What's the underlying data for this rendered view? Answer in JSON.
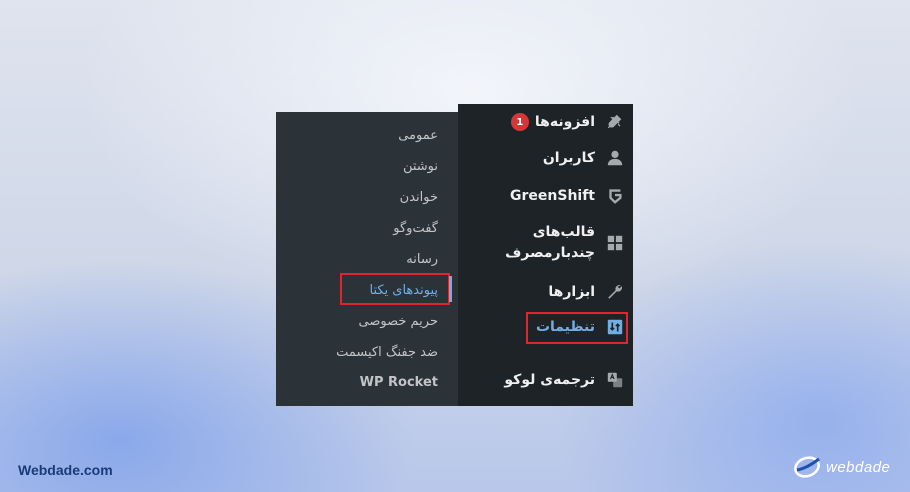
{
  "main_menu": {
    "items": [
      {
        "label": "افزونه‌ها",
        "icon": "plugins-icon",
        "badge": "1"
      },
      {
        "label": "کاربران",
        "icon": "users-icon"
      },
      {
        "label": "GreenShift",
        "icon": "greenshift-icon"
      },
      {
        "label_line1": "قالب‌های",
        "label_line2": "چندبارمصرف",
        "icon": "blocks-icon"
      },
      {
        "label": "ابزارها",
        "icon": "tools-icon"
      },
      {
        "label": "تنظیمات",
        "icon": "settings-icon",
        "current": true
      },
      {
        "label": "ترجمه‌ی لوکو",
        "icon": "translate-icon"
      }
    ]
  },
  "settings_submenu": {
    "items": [
      {
        "label": "عمومی"
      },
      {
        "label": "نوشتن"
      },
      {
        "label": "خواندن"
      },
      {
        "label": "گفت‌وگو"
      },
      {
        "label": "رسانه"
      },
      {
        "label": "پیوندهای یکتا",
        "current": true
      },
      {
        "label": "حریم خصوصی"
      },
      {
        "label": "ضد جفنگ اکیسمت"
      },
      {
        "label": "WP Rocket"
      }
    ]
  },
  "colors": {
    "menu_bg": "#1d2327",
    "submenu_bg": "#2c3338",
    "accent": "#72aee6",
    "highlight_border": "#e0262d",
    "badge": "#d63638"
  },
  "watermark": {
    "site": "Webdade.com",
    "logo_text": "webdade"
  }
}
